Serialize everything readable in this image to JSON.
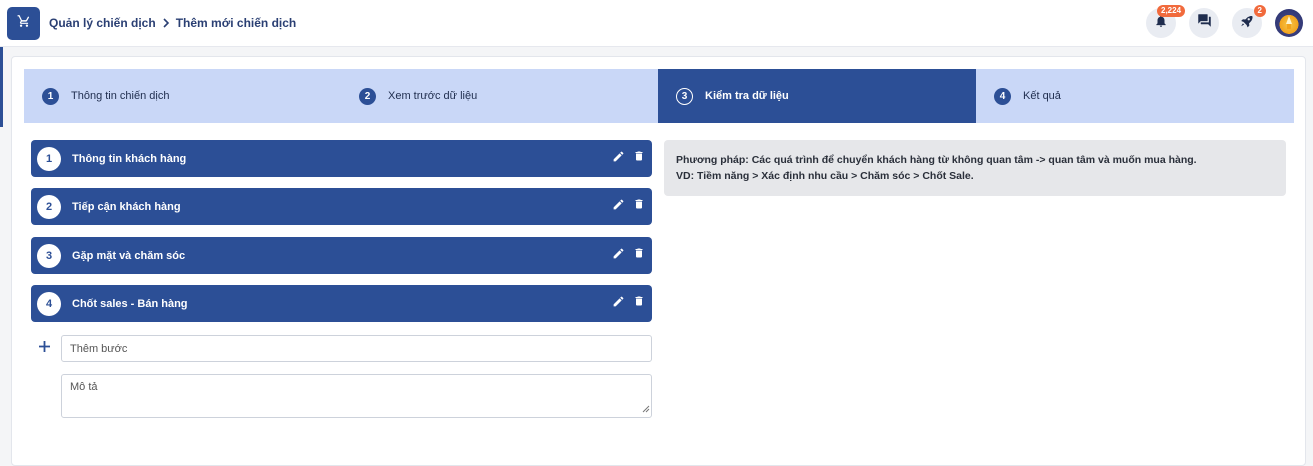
{
  "breadcrumb": {
    "parent": "Quản lý chiến dịch",
    "current": "Thêm mới chiến dịch"
  },
  "notifications": {
    "count": "2,224"
  },
  "rocket": {
    "count": "2"
  },
  "stepper": [
    {
      "num": "1",
      "label": "Thông tin chiến dịch"
    },
    {
      "num": "2",
      "label": "Xem trước dữ liệu"
    },
    {
      "num": "3",
      "label": "Kiểm tra dữ liệu"
    },
    {
      "num": "4",
      "label": "Kết quả"
    }
  ],
  "active_step": 3,
  "stages": [
    {
      "num": "1",
      "title": "Thông tin khách hàng"
    },
    {
      "num": "2",
      "title": "Tiếp cận khách hàng"
    },
    {
      "num": "3",
      "title": "Gặp mặt và chăm sóc"
    },
    {
      "num": "4",
      "title": "Chốt sales - Bán hàng"
    }
  ],
  "add_step": {
    "placeholder": "Thêm bước"
  },
  "description": {
    "placeholder": "Mô tả"
  },
  "info": {
    "line1": "Phương pháp: Các quá trình để chuyển khách hàng từ không quan tâm -> quan tâm và muốn mua hàng.",
    "line2": "VD: Tiềm năng > Xác định nhu cầu > Chăm sóc > Chốt Sale."
  },
  "colors": {
    "primary": "#2c4f96",
    "step_inactive": "#c9d7f7",
    "badge": "#f16a3c",
    "info_bg": "#e6e7ea"
  },
  "icons": [
    "cart-icon",
    "chevron-right-icon",
    "bell-icon",
    "chat-icon",
    "rocket-icon",
    "edit-icon",
    "trash-icon",
    "plus-icon"
  ]
}
